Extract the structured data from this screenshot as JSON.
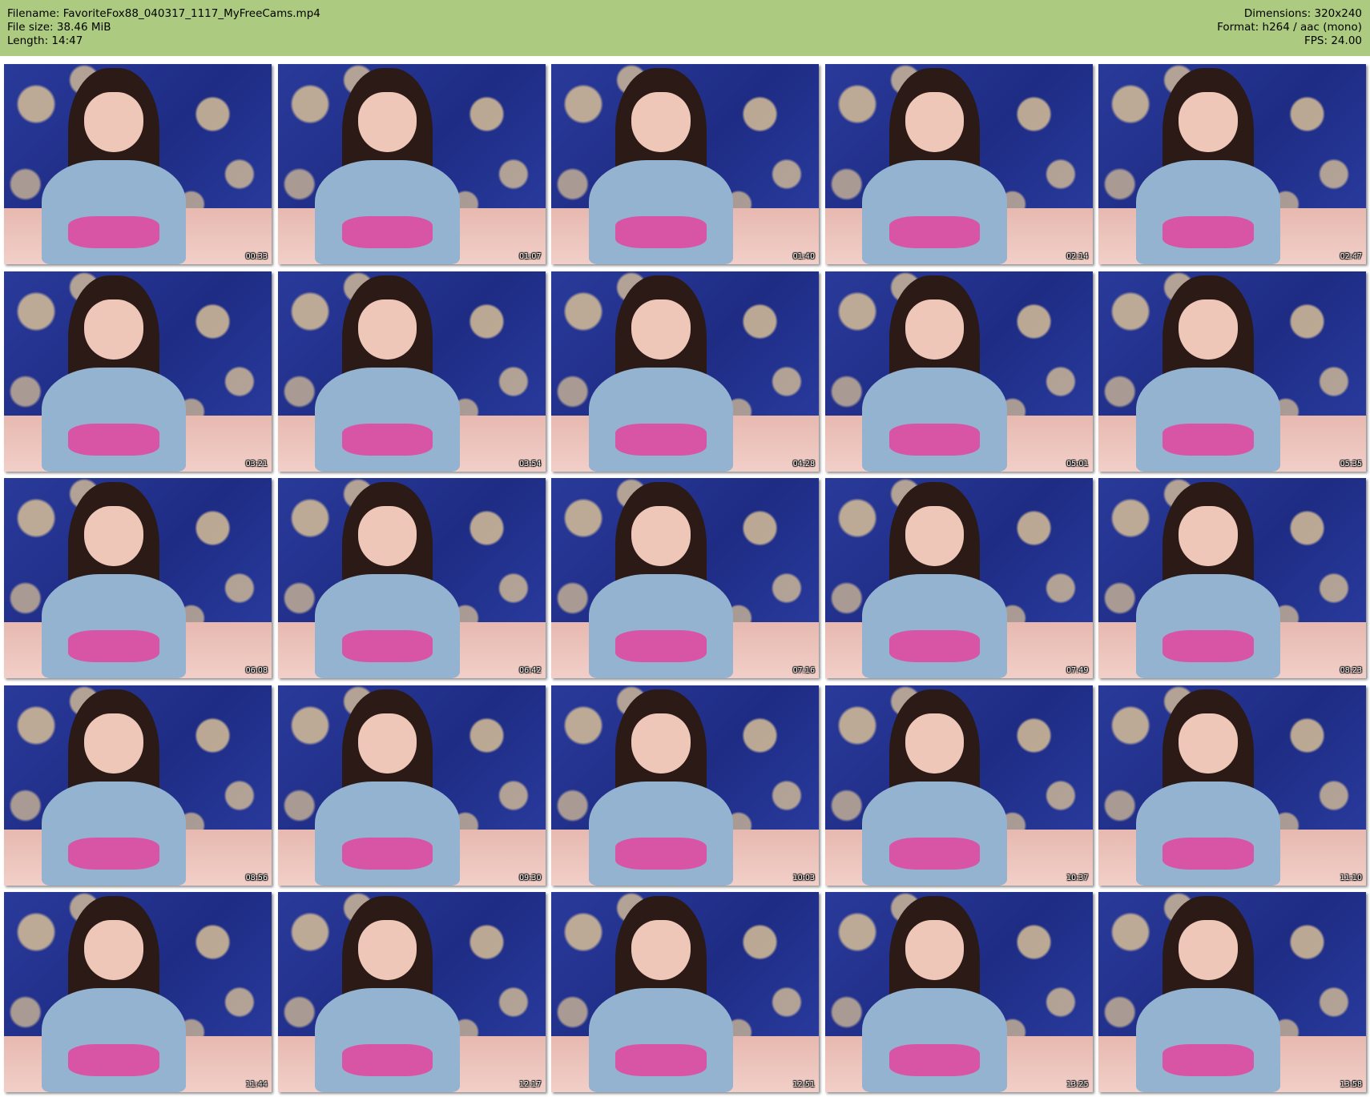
{
  "header": {
    "filename": "Filename: FavoriteFox88_040317_1117_MyFreeCams.mp4",
    "filesize": "File size: 38.46 MiB",
    "length": "Length: 14:47",
    "dimensions": "Dimensions: 320x240",
    "format": "Format: h264 / aac (mono)",
    "fps": "FPS: 24.00"
  },
  "thumbnails": [
    {
      "time": "00:33"
    },
    {
      "time": "01:07"
    },
    {
      "time": "01:40"
    },
    {
      "time": "02:14"
    },
    {
      "time": "02:47"
    },
    {
      "time": "03:21"
    },
    {
      "time": "03:54"
    },
    {
      "time": "04:28"
    },
    {
      "time": "05:01"
    },
    {
      "time": "05:35"
    },
    {
      "time": "06:08"
    },
    {
      "time": "06:42"
    },
    {
      "time": "07:16"
    },
    {
      "time": "07:49"
    },
    {
      "time": "08:23"
    },
    {
      "time": "08:56"
    },
    {
      "time": "09:30"
    },
    {
      "time": "10:03"
    },
    {
      "time": "10:37"
    },
    {
      "time": "11:10"
    },
    {
      "time": "11:44"
    },
    {
      "time": "12:17"
    },
    {
      "time": "12:51"
    },
    {
      "time": "13:25"
    },
    {
      "time": "13:58"
    }
  ],
  "colors": {
    "header_bg": "#adcb80",
    "background_curtain": "#2a3a9a",
    "shirt": "#93b3d1"
  }
}
